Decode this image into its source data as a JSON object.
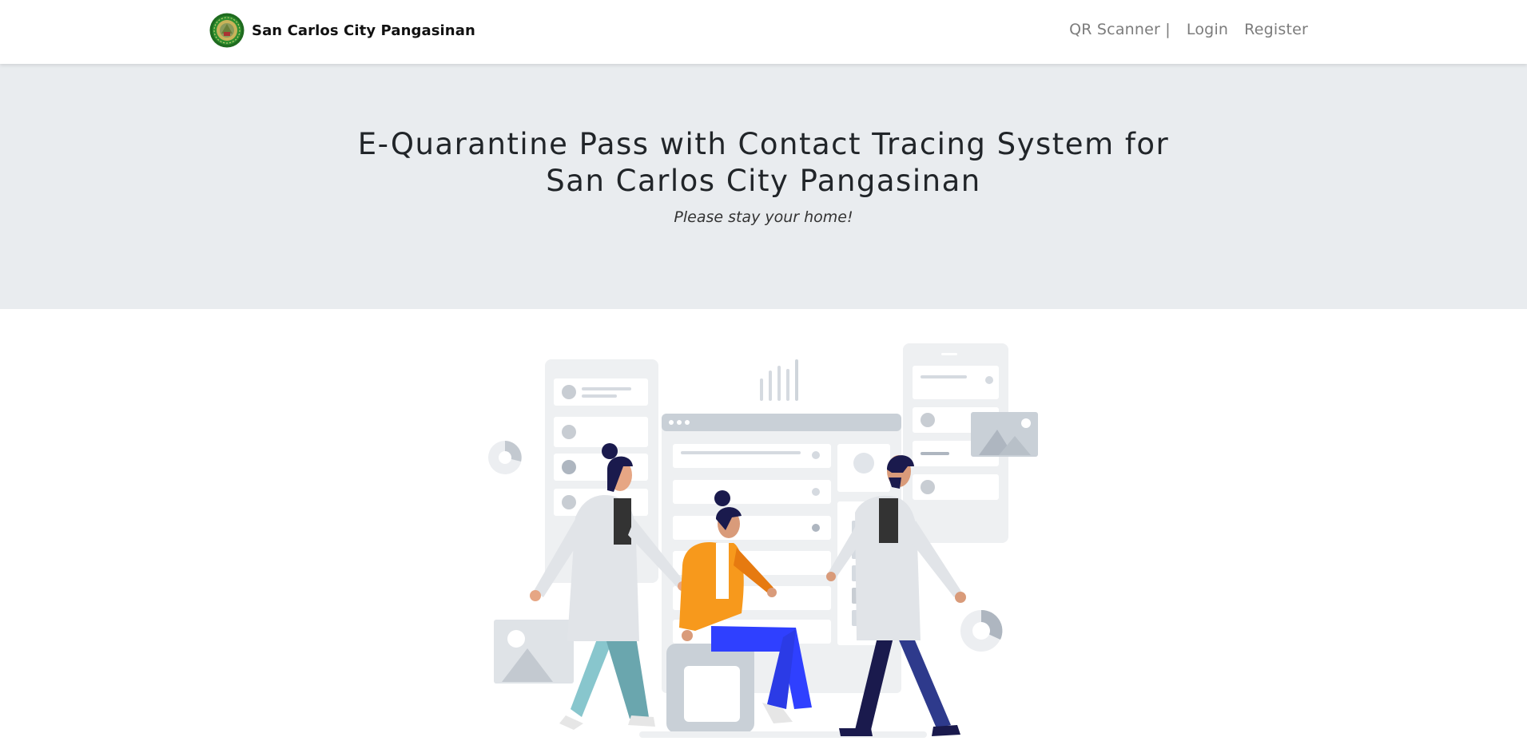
{
  "navbar": {
    "brand": {
      "name": "San Carlos City Pangasinan",
      "logo_icon": "city-seal-logo"
    },
    "links": [
      {
        "label": "QR Scanner |"
      },
      {
        "label": "Login"
      },
      {
        "label": "Register"
      }
    ]
  },
  "hero": {
    "title": "E-Quarantine Pass with Contact Tracing System for San Carlos City Pangasinan",
    "subtitle": "Please stay your home!"
  },
  "illustration": {
    "icon": "medical-team-illustration",
    "colors": {
      "doctor_coat": "#dfe2e6",
      "scrubs": "#7fc2c9",
      "patient_jacket": "#f7991c",
      "patient_pants": "#2f40ff",
      "doctor_pants": "#1a1a4d",
      "ui_panels": "#eef0f2"
    }
  }
}
